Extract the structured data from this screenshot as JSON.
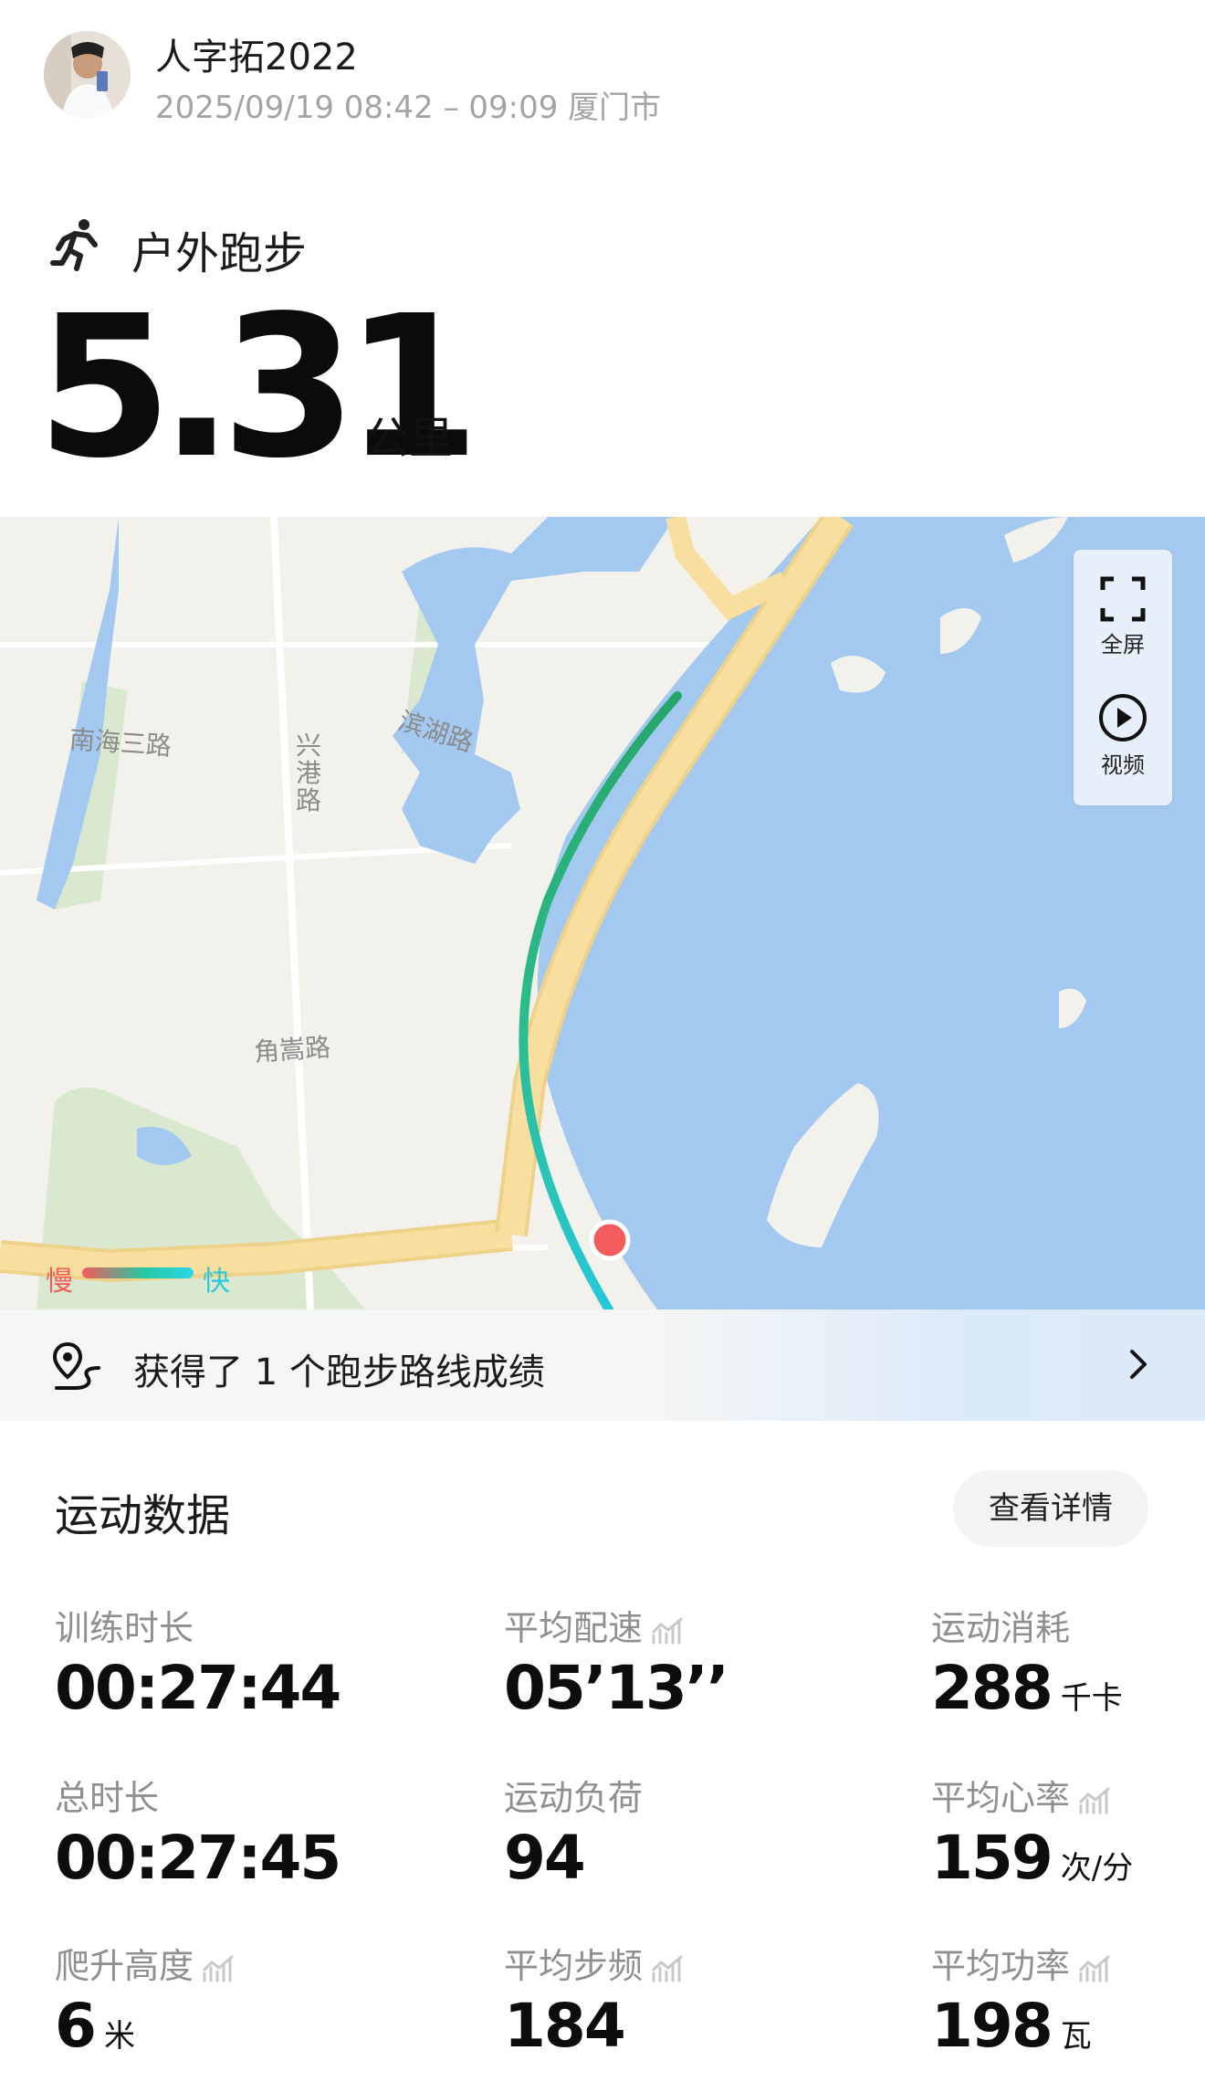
{
  "header": {
    "user_name": "人字拓2022",
    "timestamp_location": "2025/09/19 08:42 – 09:09 厦门市"
  },
  "activity": {
    "type": "户外跑步",
    "distance": "5.31",
    "distance_unit": "公里"
  },
  "map": {
    "labels": {
      "road_nanhai": "南海三路",
      "road_xinggang": "兴港路",
      "road_binhu": "滨湖路",
      "road_jiaosong": "角嵩路"
    },
    "controls": {
      "fullscreen": "全屏",
      "video": "视频"
    },
    "speed_legend": {
      "slow": "慢",
      "fast": "快"
    },
    "colors": {
      "water": "#a4c9f0",
      "road": "#f8dfa0",
      "green": "#d9e9cf",
      "route_start": "#2dbb8a",
      "route_end": "#27c9d9",
      "start_marker": "#f45b5b"
    }
  },
  "achievement": {
    "text": "获得了 1 个跑步路线成绩"
  },
  "stats": {
    "title": "运动数据",
    "detail_button": "查看详情",
    "items": [
      {
        "label": "训练时长",
        "value": "00:27:44",
        "unit": "",
        "chart_icon": false
      },
      {
        "label": "平均配速",
        "value": "05’13’’",
        "unit": "",
        "chart_icon": true
      },
      {
        "label": "运动消耗",
        "value": "288",
        "unit": "千卡",
        "chart_icon": false
      },
      {
        "label": "总时长",
        "value": "00:27:45",
        "unit": "",
        "chart_icon": false
      },
      {
        "label": "运动负荷",
        "value": "94",
        "unit": "",
        "chart_icon": false
      },
      {
        "label": "平均心率",
        "value": "159",
        "unit": "次/分",
        "chart_icon": true
      },
      {
        "label": "爬升高度",
        "value": "6",
        "unit": "米",
        "chart_icon": true
      },
      {
        "label": "平均步频",
        "value": "184",
        "unit": "",
        "chart_icon": true
      },
      {
        "label": "平均功率",
        "value": "198",
        "unit": "瓦",
        "chart_icon": true
      }
    ]
  }
}
